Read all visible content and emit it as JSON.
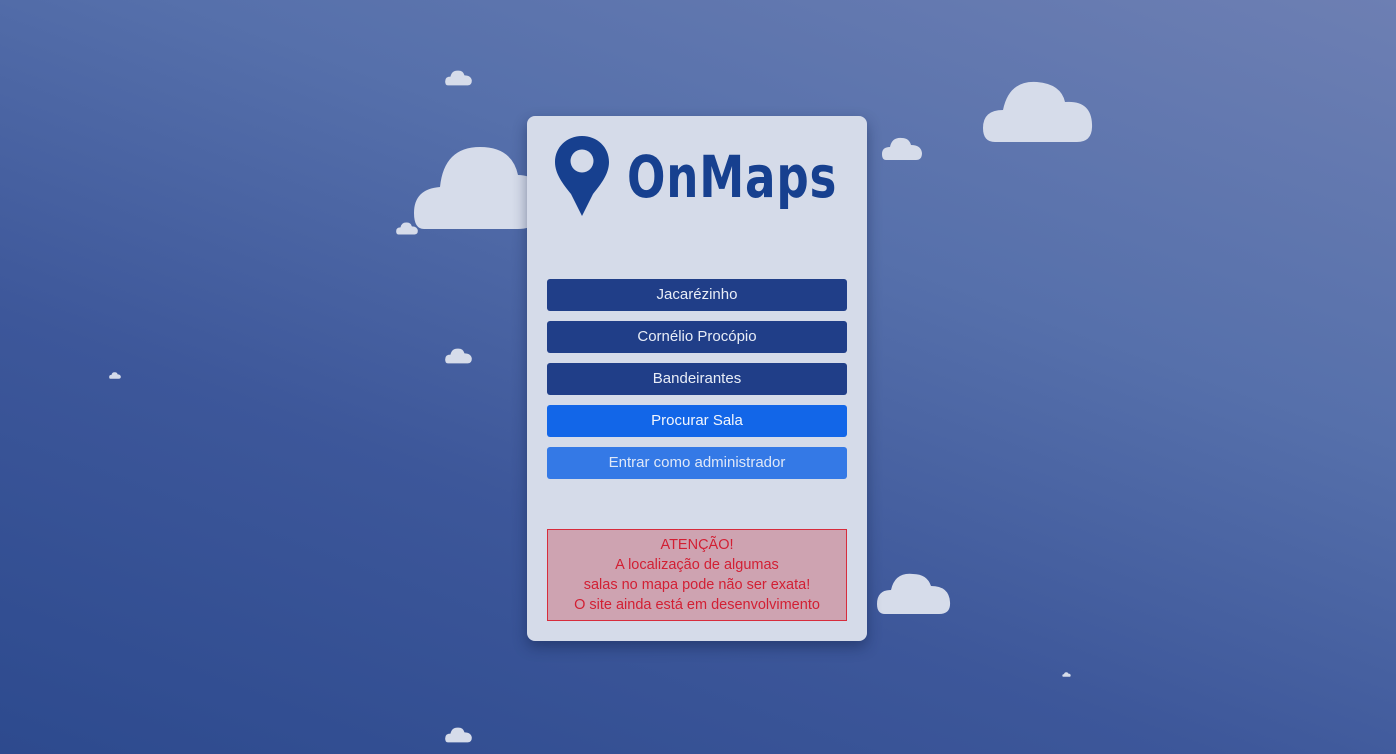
{
  "app": {
    "brand_name": "OnMaps",
    "brand_color": "#17408f"
  },
  "icons": {
    "logo": "map-pin-icon",
    "decor": "cloud-icon"
  },
  "menu": {
    "buttons": [
      {
        "label": "Jacarézinho",
        "color": "#203e88"
      },
      {
        "label": "Cornélio Procópio",
        "color": "#203e88"
      },
      {
        "label": "Bandeirantes",
        "color": "#203e88"
      },
      {
        "label": "Procurar Sala",
        "color": "#1266e8"
      },
      {
        "label": "Entrar como administrador",
        "color": "#3479e6"
      }
    ]
  },
  "warning": {
    "lines": [
      "ATENÇÃO!",
      "A localização de algumas",
      "salas no mapa pode não ser exata!",
      "O site ainda está em desenvolvimento"
    ],
    "color": "#d21f33"
  }
}
